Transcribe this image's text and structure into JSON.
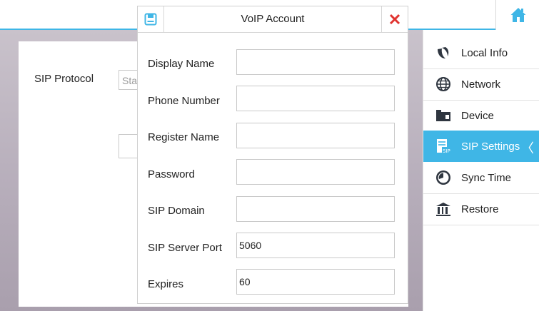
{
  "background": {
    "sip_protocol_label": "SIP Protocol",
    "sip_protocol_value": "Sta"
  },
  "sidebar": {
    "items": [
      {
        "label": "Local Info",
        "icon": "local-info-icon"
      },
      {
        "label": "Network",
        "icon": "globe-icon"
      },
      {
        "label": "Device",
        "icon": "device-icon"
      },
      {
        "label": "SIP Settings",
        "icon": "sip-icon",
        "active": true
      },
      {
        "label": "Sync Time",
        "icon": "clock-icon"
      },
      {
        "label": "Restore",
        "icon": "restore-icon"
      }
    ],
    "active_chevron": "〈"
  },
  "dialog": {
    "title": "VoIP Account",
    "fields": [
      {
        "label": "Display Name",
        "value": ""
      },
      {
        "label": "Phone Number",
        "value": ""
      },
      {
        "label": "Register Name",
        "value": ""
      },
      {
        "label": "Password",
        "value": ""
      },
      {
        "label": "SIP Domain",
        "value": ""
      },
      {
        "label": "SIP Server Port",
        "value": "5060"
      },
      {
        "label": "Expires",
        "value": "60"
      }
    ]
  },
  "colors": {
    "accent": "#3fb6e6",
    "close_red": "#e0332f",
    "icon_dark": "#2f3640"
  }
}
